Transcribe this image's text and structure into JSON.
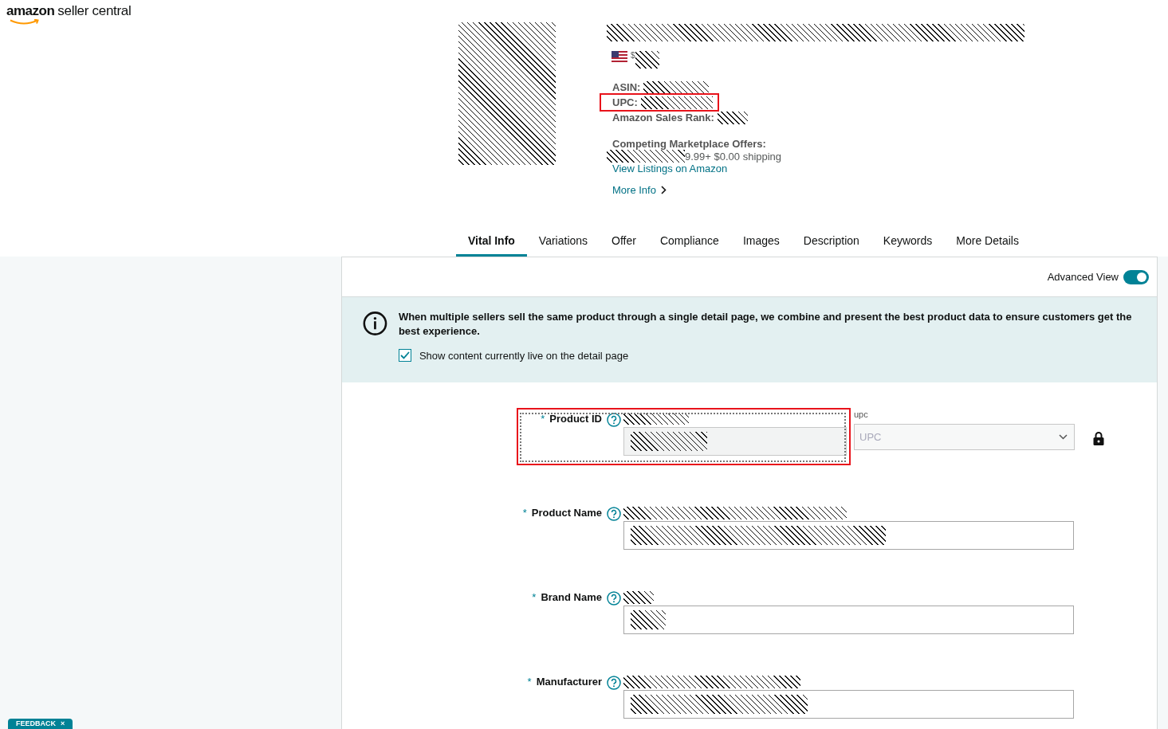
{
  "brand": {
    "logo_main": "amazon",
    "logo_sub": "seller central"
  },
  "product": {
    "price_symbol": "$",
    "fields": [
      {
        "label": "ASIN:",
        "highlighted": false
      },
      {
        "label": "UPC:",
        "highlighted": true
      },
      {
        "label": "Amazon Sales Rank:",
        "highlighted": false
      }
    ],
    "offers_title": "Competing Marketplace Offers:",
    "offers_text": "9.99+ $0.00 shipping",
    "view_listings": "View Listings on Amazon",
    "more_info": "More Info"
  },
  "tabs": [
    {
      "label": "Vital Info",
      "selected": true
    },
    {
      "label": "Variations",
      "selected": false
    },
    {
      "label": "Offer",
      "selected": false
    },
    {
      "label": "Compliance",
      "selected": false
    },
    {
      "label": "Images",
      "selected": false
    },
    {
      "label": "Description",
      "selected": false
    },
    {
      "label": "Keywords",
      "selected": false
    },
    {
      "label": "More Details",
      "selected": false
    }
  ],
  "advanced_view": {
    "label": "Advanced View",
    "on": true
  },
  "banner": {
    "text": "When multiple sellers sell the same product through a single detail page, we combine and present the best product data to ensure customers get the best experience.",
    "checkbox": {
      "label": "Show content currently live on the detail page",
      "checked": true
    }
  },
  "form": {
    "required_mark": "*",
    "fields": [
      {
        "kind": "id",
        "label": "Product ID",
        "required": true,
        "highlighted": true,
        "disabled": true,
        "type_label": "upc",
        "type_value": "UPC"
      },
      {
        "kind": "text",
        "label": "Product Name",
        "required": true,
        "highlighted": false,
        "disabled": false
      },
      {
        "kind": "text",
        "label": "Brand Name",
        "required": true,
        "highlighted": false,
        "disabled": false
      },
      {
        "kind": "text",
        "label": "Manufacturer",
        "required": true,
        "highlighted": false,
        "disabled": false
      }
    ]
  },
  "feedback": {
    "label": "FEEDBACK",
    "close": "×"
  }
}
